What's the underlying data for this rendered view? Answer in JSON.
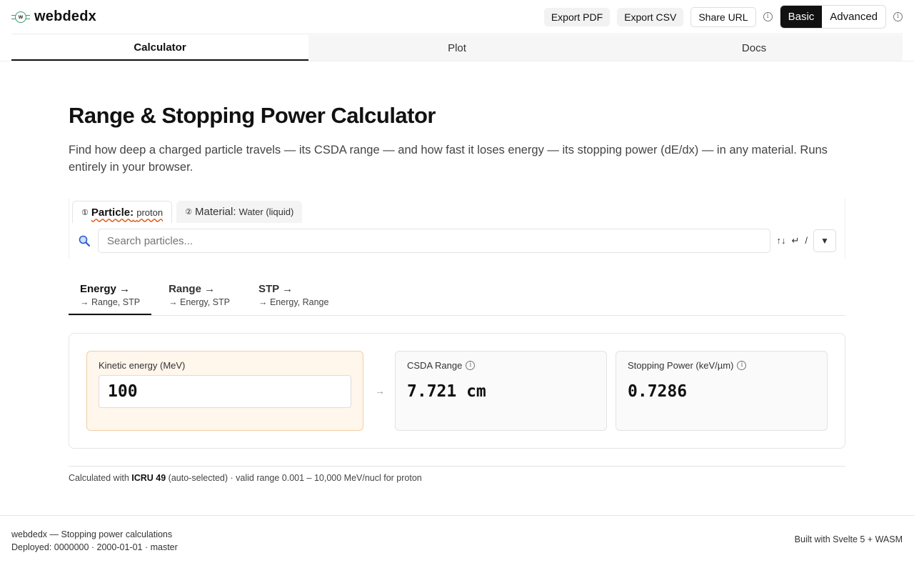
{
  "app": {
    "name": "webdedx"
  },
  "header": {
    "export_pdf": "Export PDF",
    "export_csv": "Export CSV",
    "share_url": "Share URL",
    "mode_basic": "Basic",
    "mode_advanced": "Advanced",
    "active_mode": "Basic"
  },
  "nav": {
    "tabs": [
      {
        "label": "Calculator",
        "active": true
      },
      {
        "label": "Plot",
        "active": false
      },
      {
        "label": "Docs",
        "active": false
      }
    ]
  },
  "page": {
    "title": "Range & Stopping Power Calculator",
    "description": "Find how deep a charged particle travels — its CSDA range — and how fast it loses energy — its stopping power (dE/dx) — in any material. Runs entirely in your browser."
  },
  "selector": {
    "tabs": [
      {
        "num": "①",
        "key": "Particle:",
        "value": "proton",
        "active": true
      },
      {
        "num": "②",
        "key": "Material:",
        "value": "Water (liquid)",
        "active": false
      }
    ],
    "search_placeholder": "Search particles...",
    "kbd_hint_1": "↑↓",
    "kbd_hint_2": "↵",
    "kbd_hint_3": "/",
    "dropdown_glyph": "▼"
  },
  "modes": [
    {
      "title": "Energy →",
      "subtitle": "→ Range, STP",
      "active": true
    },
    {
      "title": "Range →",
      "subtitle": "→ Energy, STP",
      "active": false
    },
    {
      "title": "STP →",
      "subtitle": "→ Energy, Range",
      "active": false
    }
  ],
  "calc": {
    "input_label": "Kinetic energy (MeV)",
    "input_value": "100",
    "arrow": "→",
    "range_label": "CSDA Range",
    "range_value": "7.721 cm",
    "stp_label": "Stopping Power (keV/µm)",
    "stp_value": "0.7286"
  },
  "note": {
    "prefix": "Calculated with ",
    "program": "ICRU 49",
    "suffix": " (auto-selected) · valid range 0.001 – 10,000 MeV/nucl for proton"
  },
  "footer": {
    "line1": "webdedx — Stopping power calculations",
    "line2": "Deployed: 0000000 · 2000-01-01 · master",
    "built": "Built with Svelte 5 + WASM"
  },
  "colors": {
    "accent_dark": "#111111",
    "input_card_bg": "#fff6ec",
    "input_card_border": "#f3cfa4",
    "squiggle": "#e05a1a",
    "search_icon": "#2a5bd7"
  },
  "icons": [
    "webdedx-logo-icon",
    "info-icon",
    "search-icon",
    "chevron-down-icon"
  ]
}
